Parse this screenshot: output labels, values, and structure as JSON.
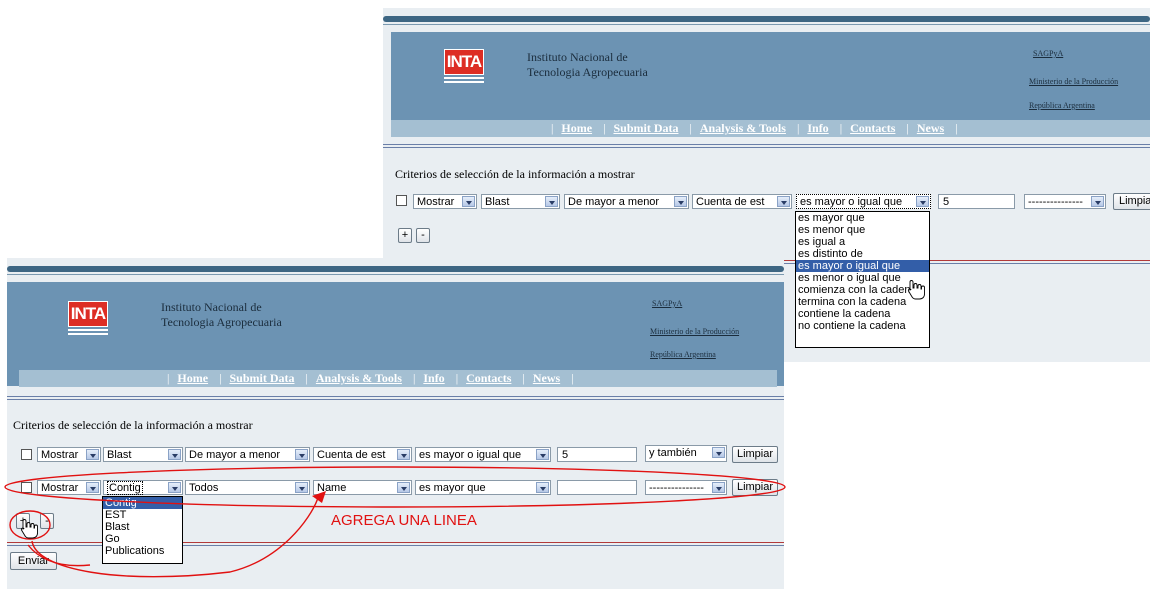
{
  "institute": {
    "line1": "Instituto Nacional de",
    "line2": "Tecnologia Agropecuaria",
    "logo_text": "INTA"
  },
  "gov_links": [
    "SAGPyA",
    "Ministerio de la Producción",
    "República Argentina"
  ],
  "nav": [
    "Home",
    "Submit Data",
    "Analysis & Tools",
    "Info",
    "Contacts",
    "News"
  ],
  "heading": "Criterios de selección de la información a mostrar",
  "back_screen": {
    "row": {
      "show": "Mostrar",
      "source": "Blast",
      "order": "De mayor a menor",
      "field": "Cuenta de est",
      "operator": "es mayor o igual que",
      "value": "5",
      "connector": "---------------",
      "clear": "Limpiar"
    },
    "add_label": "+",
    "remove_label": "-",
    "operator_options": [
      "es mayor que",
      "es menor que",
      "es igual a",
      "es distinto de",
      "es mayor o igual que",
      "es menor o igual que",
      "comienza con la cadena",
      "termina con la cadena",
      "contiene la cadena",
      "no contiene la cadena"
    ],
    "operator_highlighted": "es mayor o igual que"
  },
  "front_screen": {
    "row1": {
      "show": "Mostrar",
      "source": "Blast",
      "order": "De mayor a menor",
      "field": "Cuenta de est",
      "operator": "es mayor o igual que",
      "value": "5",
      "connector": "y también",
      "clear": "Limpiar"
    },
    "row2": {
      "show": "Mostrar",
      "source": "Contig",
      "order": "Todos",
      "field": "Name",
      "operator": "es mayor que",
      "value": "",
      "connector": "---------------",
      "clear": "Limpiar"
    },
    "add_label": "+",
    "remove_label": "-",
    "submit": "Enviar",
    "source_options": [
      "Contig",
      "EST",
      "Blast",
      "Go",
      "Publications"
    ],
    "source_highlighted": "Contig"
  },
  "annotation": {
    "text": "AGREGA UNA LINEA",
    "color": "#e11111"
  }
}
